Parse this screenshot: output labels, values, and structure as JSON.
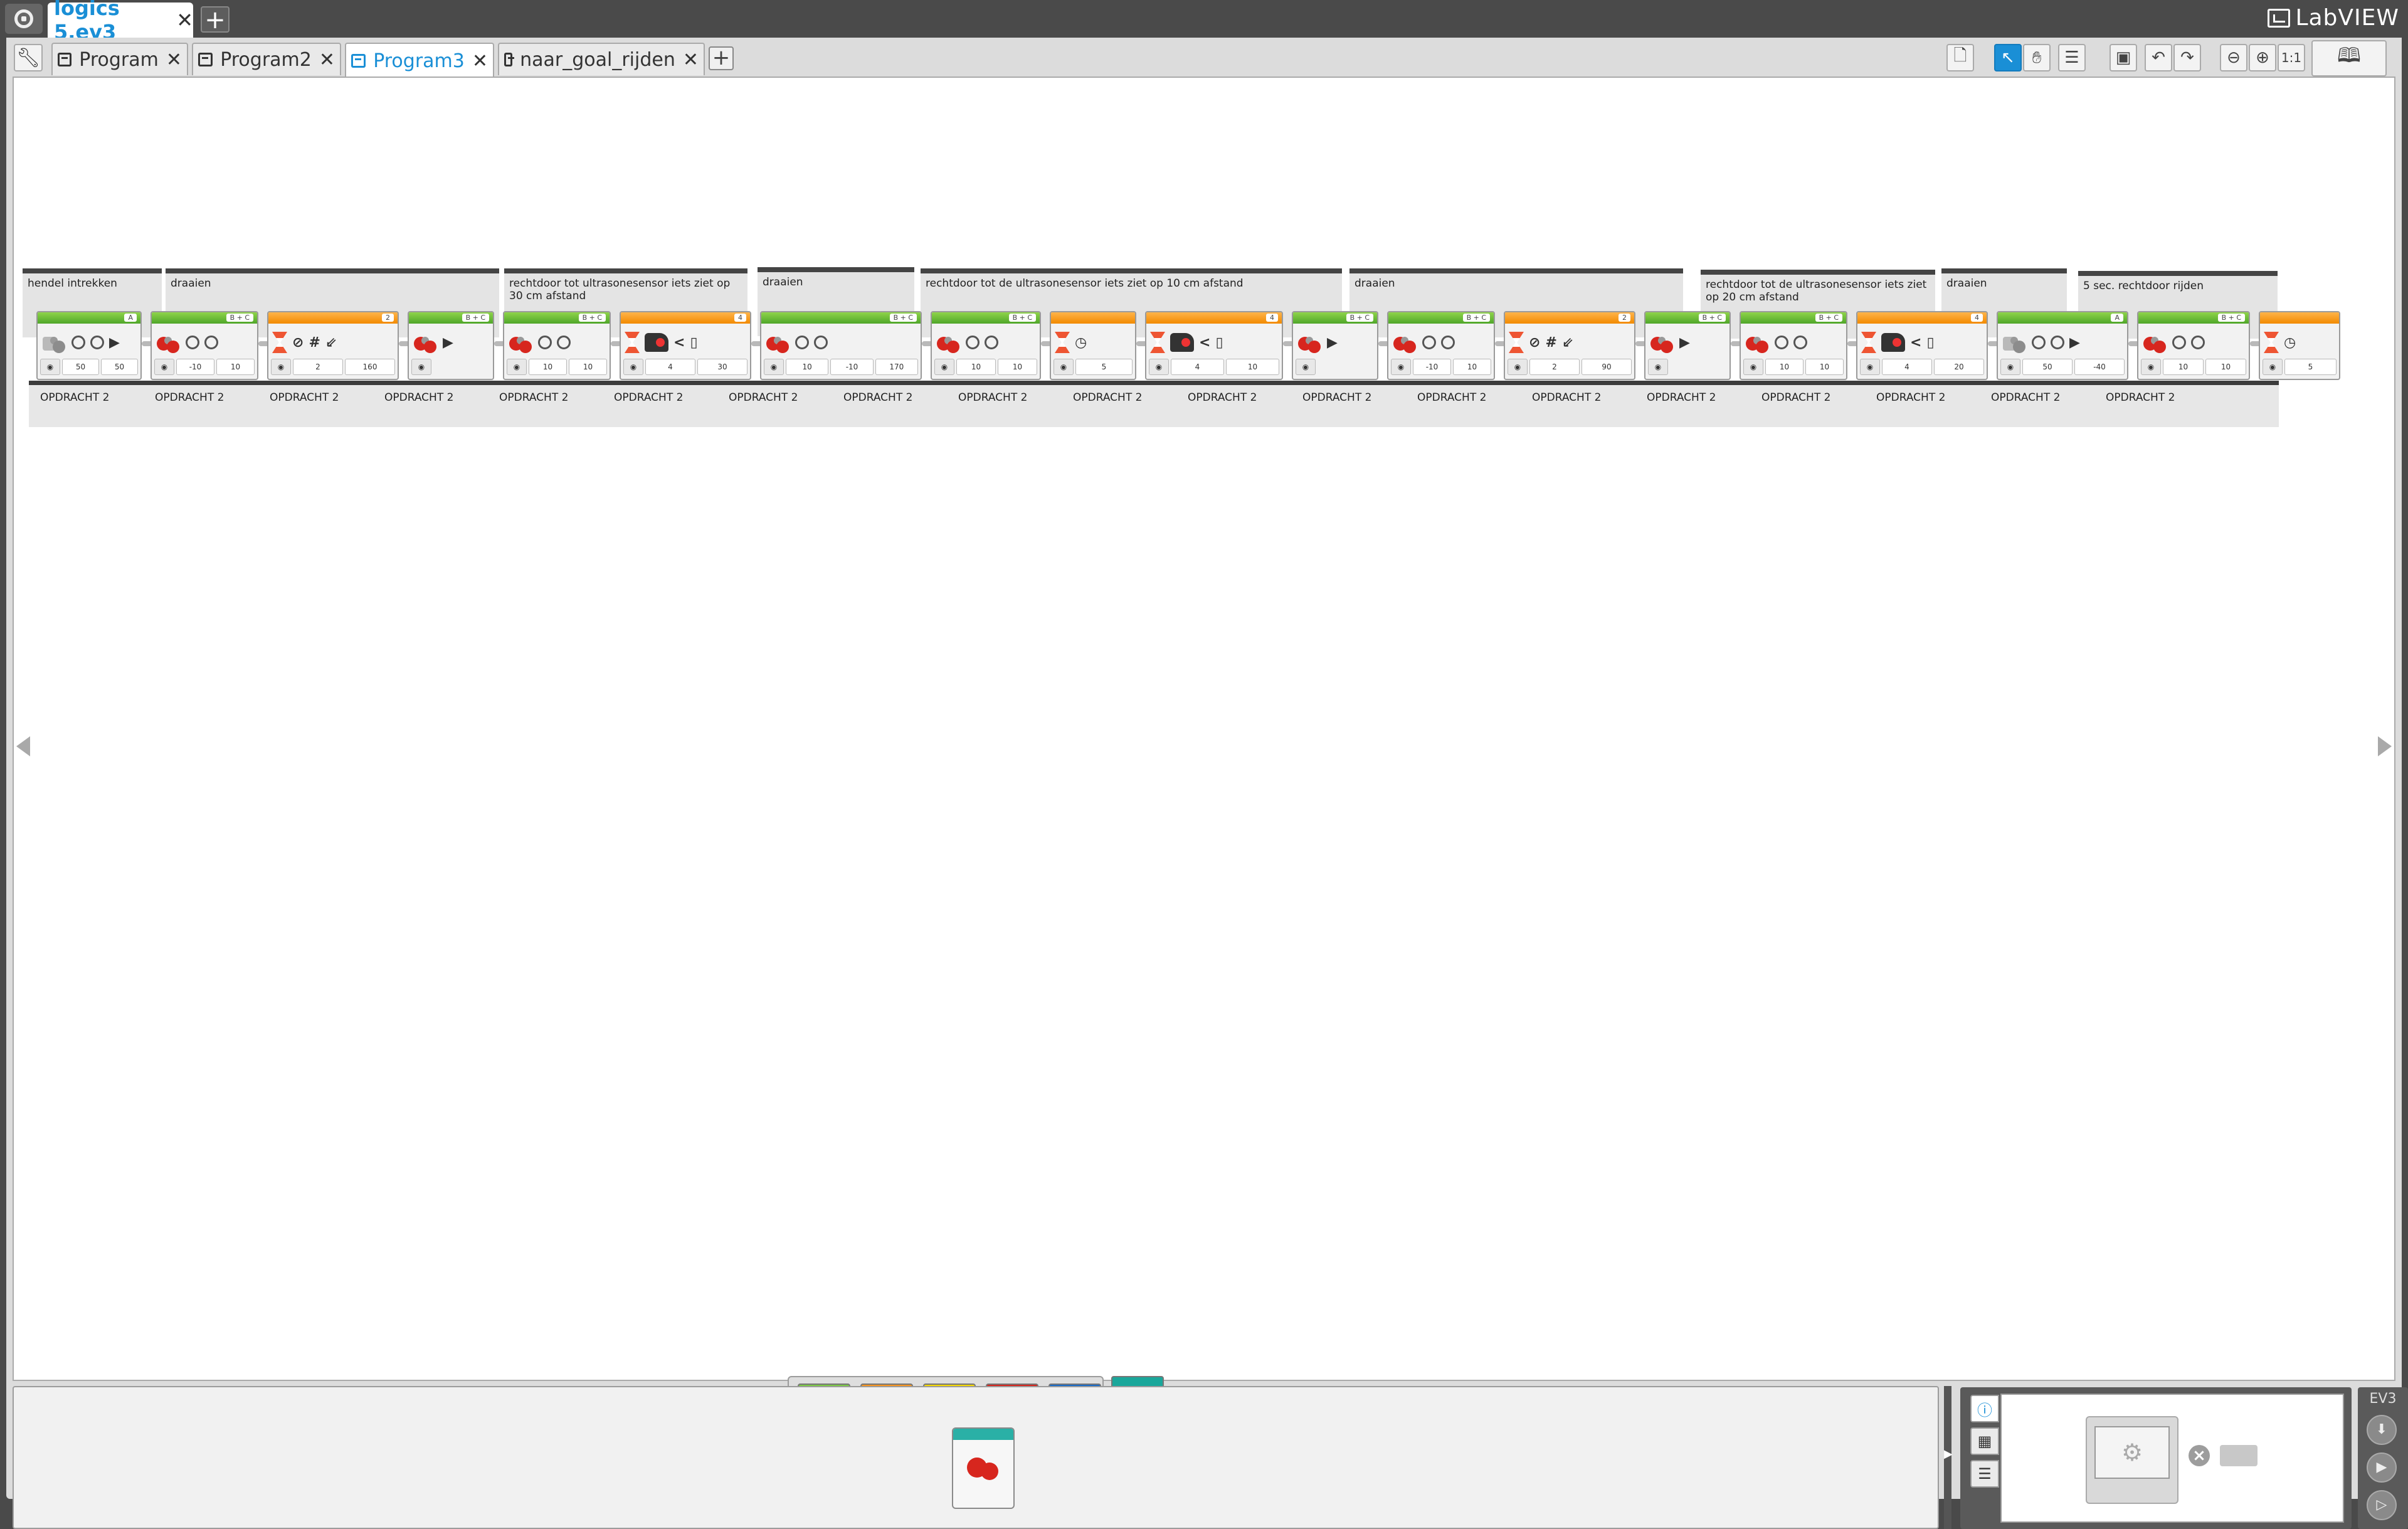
{
  "app": {
    "project_tab": "logics 5.ev3",
    "close_symbol": "✕",
    "add_symbol": "+",
    "brand": "LabVIEW"
  },
  "program_tabs": [
    {
      "label": "Program",
      "active": false
    },
    {
      "label": "Program2",
      "active": false
    },
    {
      "label": "Program3",
      "active": true
    },
    {
      "label": "naar_goal_rijden",
      "active": false
    }
  ],
  "toolbar": {
    "zoom_reset_label": "1:1",
    "icons": [
      "new-page-icon",
      "select-arrow-icon",
      "pan-hand-icon",
      "comment-icon",
      "save-icon",
      "undo-icon",
      "redo-icon",
      "zoom-out-icon",
      "zoom-in-icon",
      "zoom-reset-icon",
      "content-editor-icon"
    ]
  },
  "comments": [
    "hendel intrekken",
    "draaien",
    "rechtdoor tot ultrasonesensor iets ziet op 30 cm afstand",
    "draaien",
    "rechtdoor tot de ultrasonesensor iets ziet op 10 cm afstand",
    "draaien",
    "rechtdoor tot de ultrasonesensor iets ziet op 20 cm afstand",
    "draaien",
    "5 sec. rechtdoor rijden"
  ],
  "sequence_labels": [
    "OPDRACHT 2",
    "OPDRACHT 2",
    "OPDRACHT 2",
    "OPDRACHT 2",
    "OPDRACHT 2",
    "OPDRACHT 2",
    "OPDRACHT 2",
    "OPDRACHT 2",
    "OPDRACHT 2",
    "OPDRACHT 2",
    "OPDRACHT 2",
    "OPDRACHT 2",
    "OPDRACHT 2",
    "OPDRACHT 2",
    "OPDRACHT 2",
    "OPDRACHT 2",
    "OPDRACHT 2",
    "OPDRACHT 2",
    "OPDRACHT 2"
  ],
  "blocks": [
    {
      "name": "medium-motor-block",
      "color": "green",
      "port": "A",
      "kind": "medmotor",
      "values": [
        "50",
        "50"
      ]
    },
    {
      "name": "move-tank-block",
      "color": "green",
      "port": "B + C",
      "kind": "motor",
      "values": [
        "-10",
        "10"
      ]
    },
    {
      "name": "wait-gyro-block",
      "color": "orange",
      "port": "2",
      "kind": "wait",
      "values": [
        "2",
        "160"
      ]
    },
    {
      "name": "move-tank-stop-block",
      "color": "green",
      "port": "B + C",
      "kind": "stop",
      "values": []
    },
    {
      "name": "move-tank-block",
      "color": "green",
      "port": "B + C",
      "kind": "motor",
      "values": [
        "10",
        "10"
      ]
    },
    {
      "name": "wait-ultrasonic-block",
      "color": "orange",
      "port": "4",
      "kind": "wait-us",
      "values": [
        "4",
        "30"
      ]
    },
    {
      "name": "move-tank-degrees-block",
      "color": "green",
      "port": "B + C",
      "kind": "motor",
      "values": [
        "10",
        "-10",
        "170"
      ]
    },
    {
      "name": "move-tank-block",
      "color": "green",
      "port": "B + C",
      "kind": "motor",
      "values": [
        "10",
        "10"
      ]
    },
    {
      "name": "wait-time-block",
      "color": "orange",
      "port": "",
      "kind": "wait-time",
      "values": [
        "5"
      ]
    },
    {
      "name": "wait-ultrasonic-block",
      "color": "orange",
      "port": "4",
      "kind": "wait-us",
      "values": [
        "4",
        "10"
      ]
    },
    {
      "name": "move-tank-stop-block",
      "color": "green",
      "port": "B + C",
      "kind": "stop",
      "values": []
    },
    {
      "name": "move-tank-block",
      "color": "green",
      "port": "B + C",
      "kind": "motor",
      "values": [
        "-10",
        "10"
      ]
    },
    {
      "name": "wait-gyro-block",
      "color": "orange",
      "port": "2",
      "kind": "wait",
      "values": [
        "2",
        "90"
      ]
    },
    {
      "name": "move-tank-stop-block",
      "color": "green",
      "port": "B + C",
      "kind": "stop",
      "values": []
    },
    {
      "name": "move-tank-block",
      "color": "green",
      "port": "B + C",
      "kind": "motor",
      "values": [
        "10",
        "10"
      ]
    },
    {
      "name": "wait-ultrasonic-block",
      "color": "orange",
      "port": "4",
      "kind": "wait-us",
      "values": [
        "4",
        "20"
      ]
    },
    {
      "name": "medium-motor-block",
      "color": "green",
      "port": "A",
      "kind": "medmotor",
      "values": [
        "50",
        "-40"
      ]
    },
    {
      "name": "move-tank-block",
      "color": "green",
      "port": "B + C",
      "kind": "motor",
      "values": [
        "10",
        "10"
      ]
    },
    {
      "name": "wait-time-block",
      "color": "orange",
      "port": "",
      "kind": "wait-time",
      "values": [
        "5"
      ]
    }
  ],
  "palette": {
    "tab_colors": [
      "#7ac943",
      "#f7941d",
      "#f5d800",
      "#d4231c",
      "#1669c7",
      "#1aa79b"
    ],
    "active_tab_index": 5
  },
  "hardware": {
    "ev3_label": "EV3",
    "tabs": [
      "brick-info-icon",
      "port-view-icon",
      "available-bricks-icon"
    ],
    "buttons": [
      "download-icon",
      "download-run-icon",
      "run-selected-icon"
    ]
  }
}
